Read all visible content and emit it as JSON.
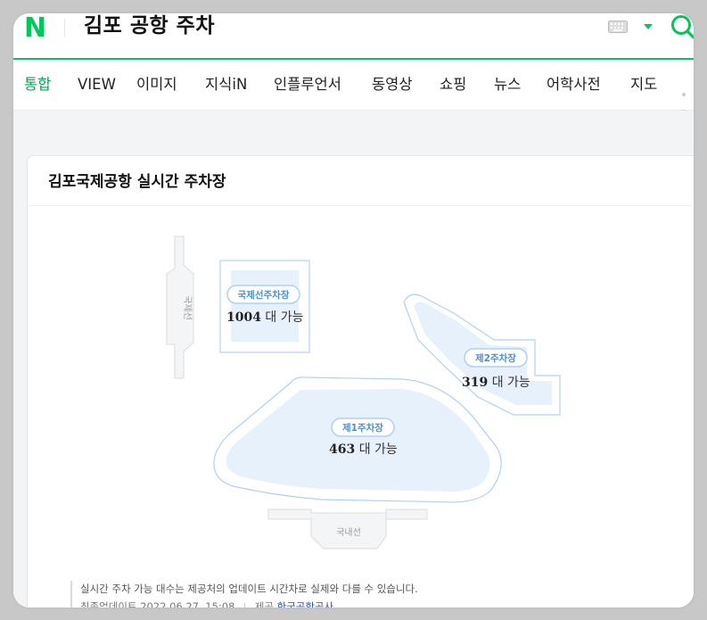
{
  "header": {
    "logo": "N",
    "query": "김포 공항 주차",
    "icons": [
      "keyboard-icon",
      "dropdown-arrow-icon",
      "search-icon"
    ],
    "brand_color": "#03c75a"
  },
  "tabs": [
    {
      "label": "통합",
      "active": true
    },
    {
      "label": "VIEW",
      "active": false
    },
    {
      "label": "이미지",
      "active": false
    },
    {
      "label": "지식iN",
      "active": false
    },
    {
      "label": "인플루언서",
      "active": false
    },
    {
      "label": "동영상",
      "active": false
    },
    {
      "label": "쇼핑",
      "active": false
    },
    {
      "label": "뉴스",
      "active": false
    },
    {
      "label": "어학사전",
      "active": false
    },
    {
      "label": "지도",
      "active": false
    }
  ],
  "card": {
    "title": "김포국제공항 실시간 주차장",
    "terminals": {
      "international": "국제선",
      "domestic": "국내선"
    },
    "lots": [
      {
        "name": "국제선주차장",
        "count": "1004",
        "unit": "대 가능"
      },
      {
        "name": "제2주차장",
        "count": "319",
        "unit": "대 가능"
      },
      {
        "name": "제1주차장",
        "count": "463",
        "unit": "대 가능"
      }
    ],
    "notice": "실시간 주차 가능 대수는 제공처의 업데이트 시간차로 실제와 다를 수 있습니다.",
    "updated_label": "최종업데이트",
    "updated_time": "2022.06.27. 15:08",
    "provider_label": "제공",
    "provider": "한국공항공사"
  },
  "colors": {
    "lot_fill": "#e6f1fc",
    "lot_stroke": "#aed2f3",
    "pill_text": "#4a8fd6",
    "terminal_fill": "#f4f5f7",
    "terminal_stroke": "#d9dbdf"
  }
}
